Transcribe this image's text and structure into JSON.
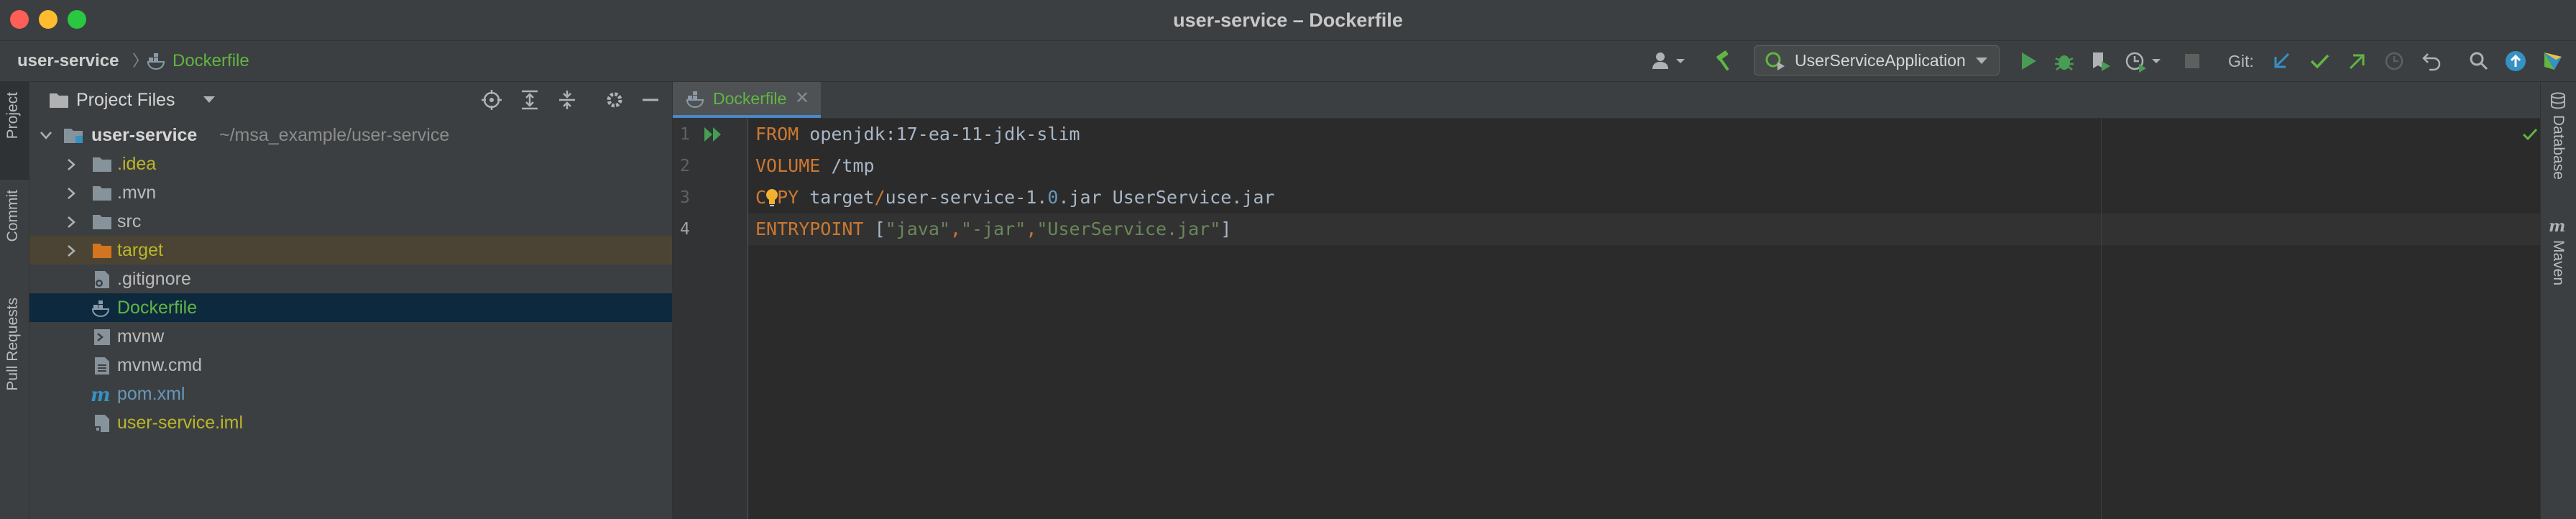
{
  "window": {
    "title": "user-service – Dockerfile"
  },
  "breadcrumb": {
    "project": "user-service",
    "separator": "〉",
    "file": "Dockerfile"
  },
  "toolbar": {
    "run_config": "UserServiceApplication",
    "git_label": "Git:"
  },
  "left_stripe": {
    "project": "Project",
    "commit": "Commit",
    "pull_requests": "Pull Requests"
  },
  "project_panel": {
    "title": "Project Files",
    "tree": [
      {
        "label": "user-service",
        "path": "~/msa_example/user-service"
      },
      {
        "label": ".idea"
      },
      {
        "label": ".mvn"
      },
      {
        "label": "src"
      },
      {
        "label": "target"
      },
      {
        "label": ".gitignore"
      },
      {
        "label": "Dockerfile"
      },
      {
        "label": "mvnw"
      },
      {
        "label": "mvnw.cmd"
      },
      {
        "label": "pom.xml"
      },
      {
        "label": "user-service.iml"
      }
    ]
  },
  "editor": {
    "tab": {
      "label": "Dockerfile",
      "close": "✕"
    },
    "line_numbers": [
      "1",
      "2",
      "3",
      "4"
    ],
    "lines": [
      {
        "kw": "FROM",
        "rest": " openjdk:17-ea-11-jdk-slim"
      },
      {
        "kw": "VOLUME",
        "rest": " /tmp"
      },
      {
        "kw_a": "C",
        "kw_b": "PY",
        "p1": " target",
        "p2": "/",
        "p3": "user-service-1.",
        "p4": "0",
        "p5": ".jar UserService.jar"
      },
      {
        "kw": "ENTRYPOINT",
        "p1": " [",
        "s1": "\"java\"",
        "c1": ",",
        "s2": "\"-jar\"",
        "c2": ",",
        "s3": "\"UserService.jar\"",
        "p2": "]"
      }
    ]
  },
  "right_stripe": {
    "database": "Database",
    "maven": "Maven"
  },
  "colors": {
    "keyword": "#cc7832",
    "string": "#6a8759",
    "number": "#6897bb",
    "accent": "#4a88c7",
    "selection": "#0d293e",
    "vcs_added": "#62b543",
    "vcs_ignored": "#bbb529"
  },
  "icons": [
    "folder-icon",
    "dockerfile-icon",
    "hammer-icon",
    "run-icon",
    "debug-icon",
    "coverage-icon",
    "profile-icon",
    "stop-icon",
    "git-update-icon",
    "git-commit-icon",
    "git-push-icon",
    "history-icon",
    "rollback-icon",
    "search-icon",
    "upload-icon",
    "jetbrains-icon",
    "locate-icon",
    "expand-all-icon",
    "collapse-all-icon",
    "gear-icon",
    "hide-icon",
    "rerun-icon",
    "bulb-icon",
    "check-icon",
    "database-icon",
    "maven-icon"
  ]
}
